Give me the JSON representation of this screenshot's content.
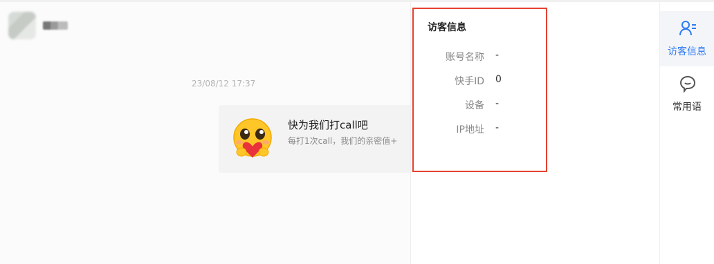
{
  "chat": {
    "timestamp": "23/08/12 17:37",
    "card": {
      "title": "快为我们打call吧",
      "subtitle": "每打1次call，我们的亲密值+"
    }
  },
  "visitor_info": {
    "title": "访客信息",
    "rows": [
      {
        "label": "账号名称",
        "value": "-"
      },
      {
        "label": "快手ID",
        "value": "0"
      },
      {
        "label": "设备",
        "value": "-"
      },
      {
        "label": "IP地址",
        "value": "-"
      }
    ]
  },
  "sidebar": {
    "items": [
      {
        "label": "访客信息",
        "icon": "visitor-info-icon",
        "active": true
      },
      {
        "label": "常用语",
        "icon": "chat-bubble-icon",
        "active": false
      }
    ]
  },
  "colors": {
    "accent": "#2f7bf5",
    "highlight_border": "#e5412f"
  }
}
